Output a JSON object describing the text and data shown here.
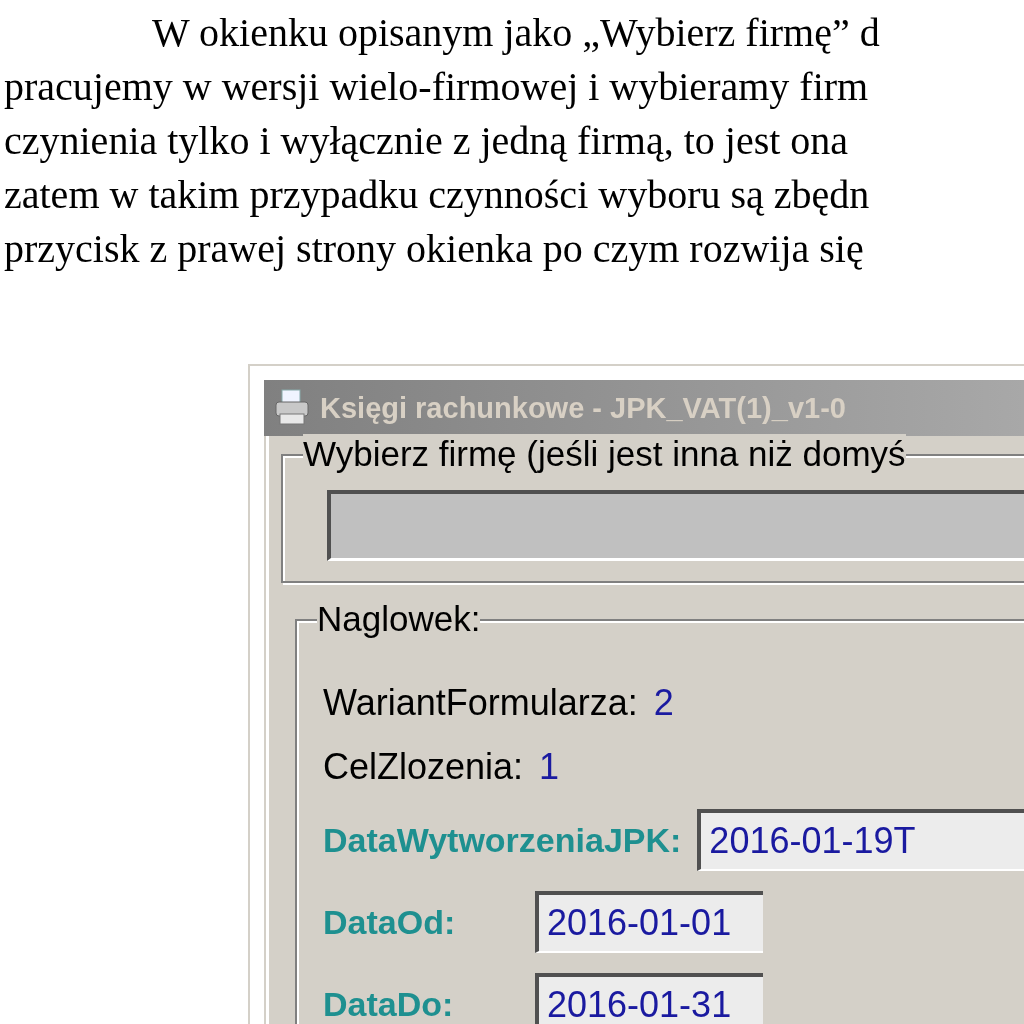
{
  "paragraph_lines": [
    "W okienku opisanym jako „Wybierz firmę” d",
    "pracujemy w wersji wielo-firmowej i wybieramy firm",
    "czynienia tylko i wyłącznie z jedną firmą, to jest ona",
    "zatem w takim przypadku czynności wyboru są zbędn",
    "przycisk z prawej strony okienka po czym rozwija się"
  ],
  "window": {
    "title": "Księgi rachunkowe - JPK_VAT(1)_v1-0"
  },
  "company_group": {
    "label": "Wybierz firmę (jeśli jest inna niż domyś",
    "disabled": true
  },
  "header_group": {
    "label": "Naglowek:",
    "fields": [
      {
        "kind": "value",
        "label": "WariantFormularza:",
        "value": "2"
      },
      {
        "kind": "value",
        "label": "CelZlozenia:",
        "value": "1"
      },
      {
        "kind": "input",
        "label": "DataWytworzeniaJPK:",
        "value": "2016-01-19T"
      },
      {
        "kind": "input",
        "label": "DataOd:",
        "value": "2016-01-01"
      },
      {
        "kind": "input",
        "label": "DataDo:",
        "value": "2016-01-31"
      }
    ]
  }
}
